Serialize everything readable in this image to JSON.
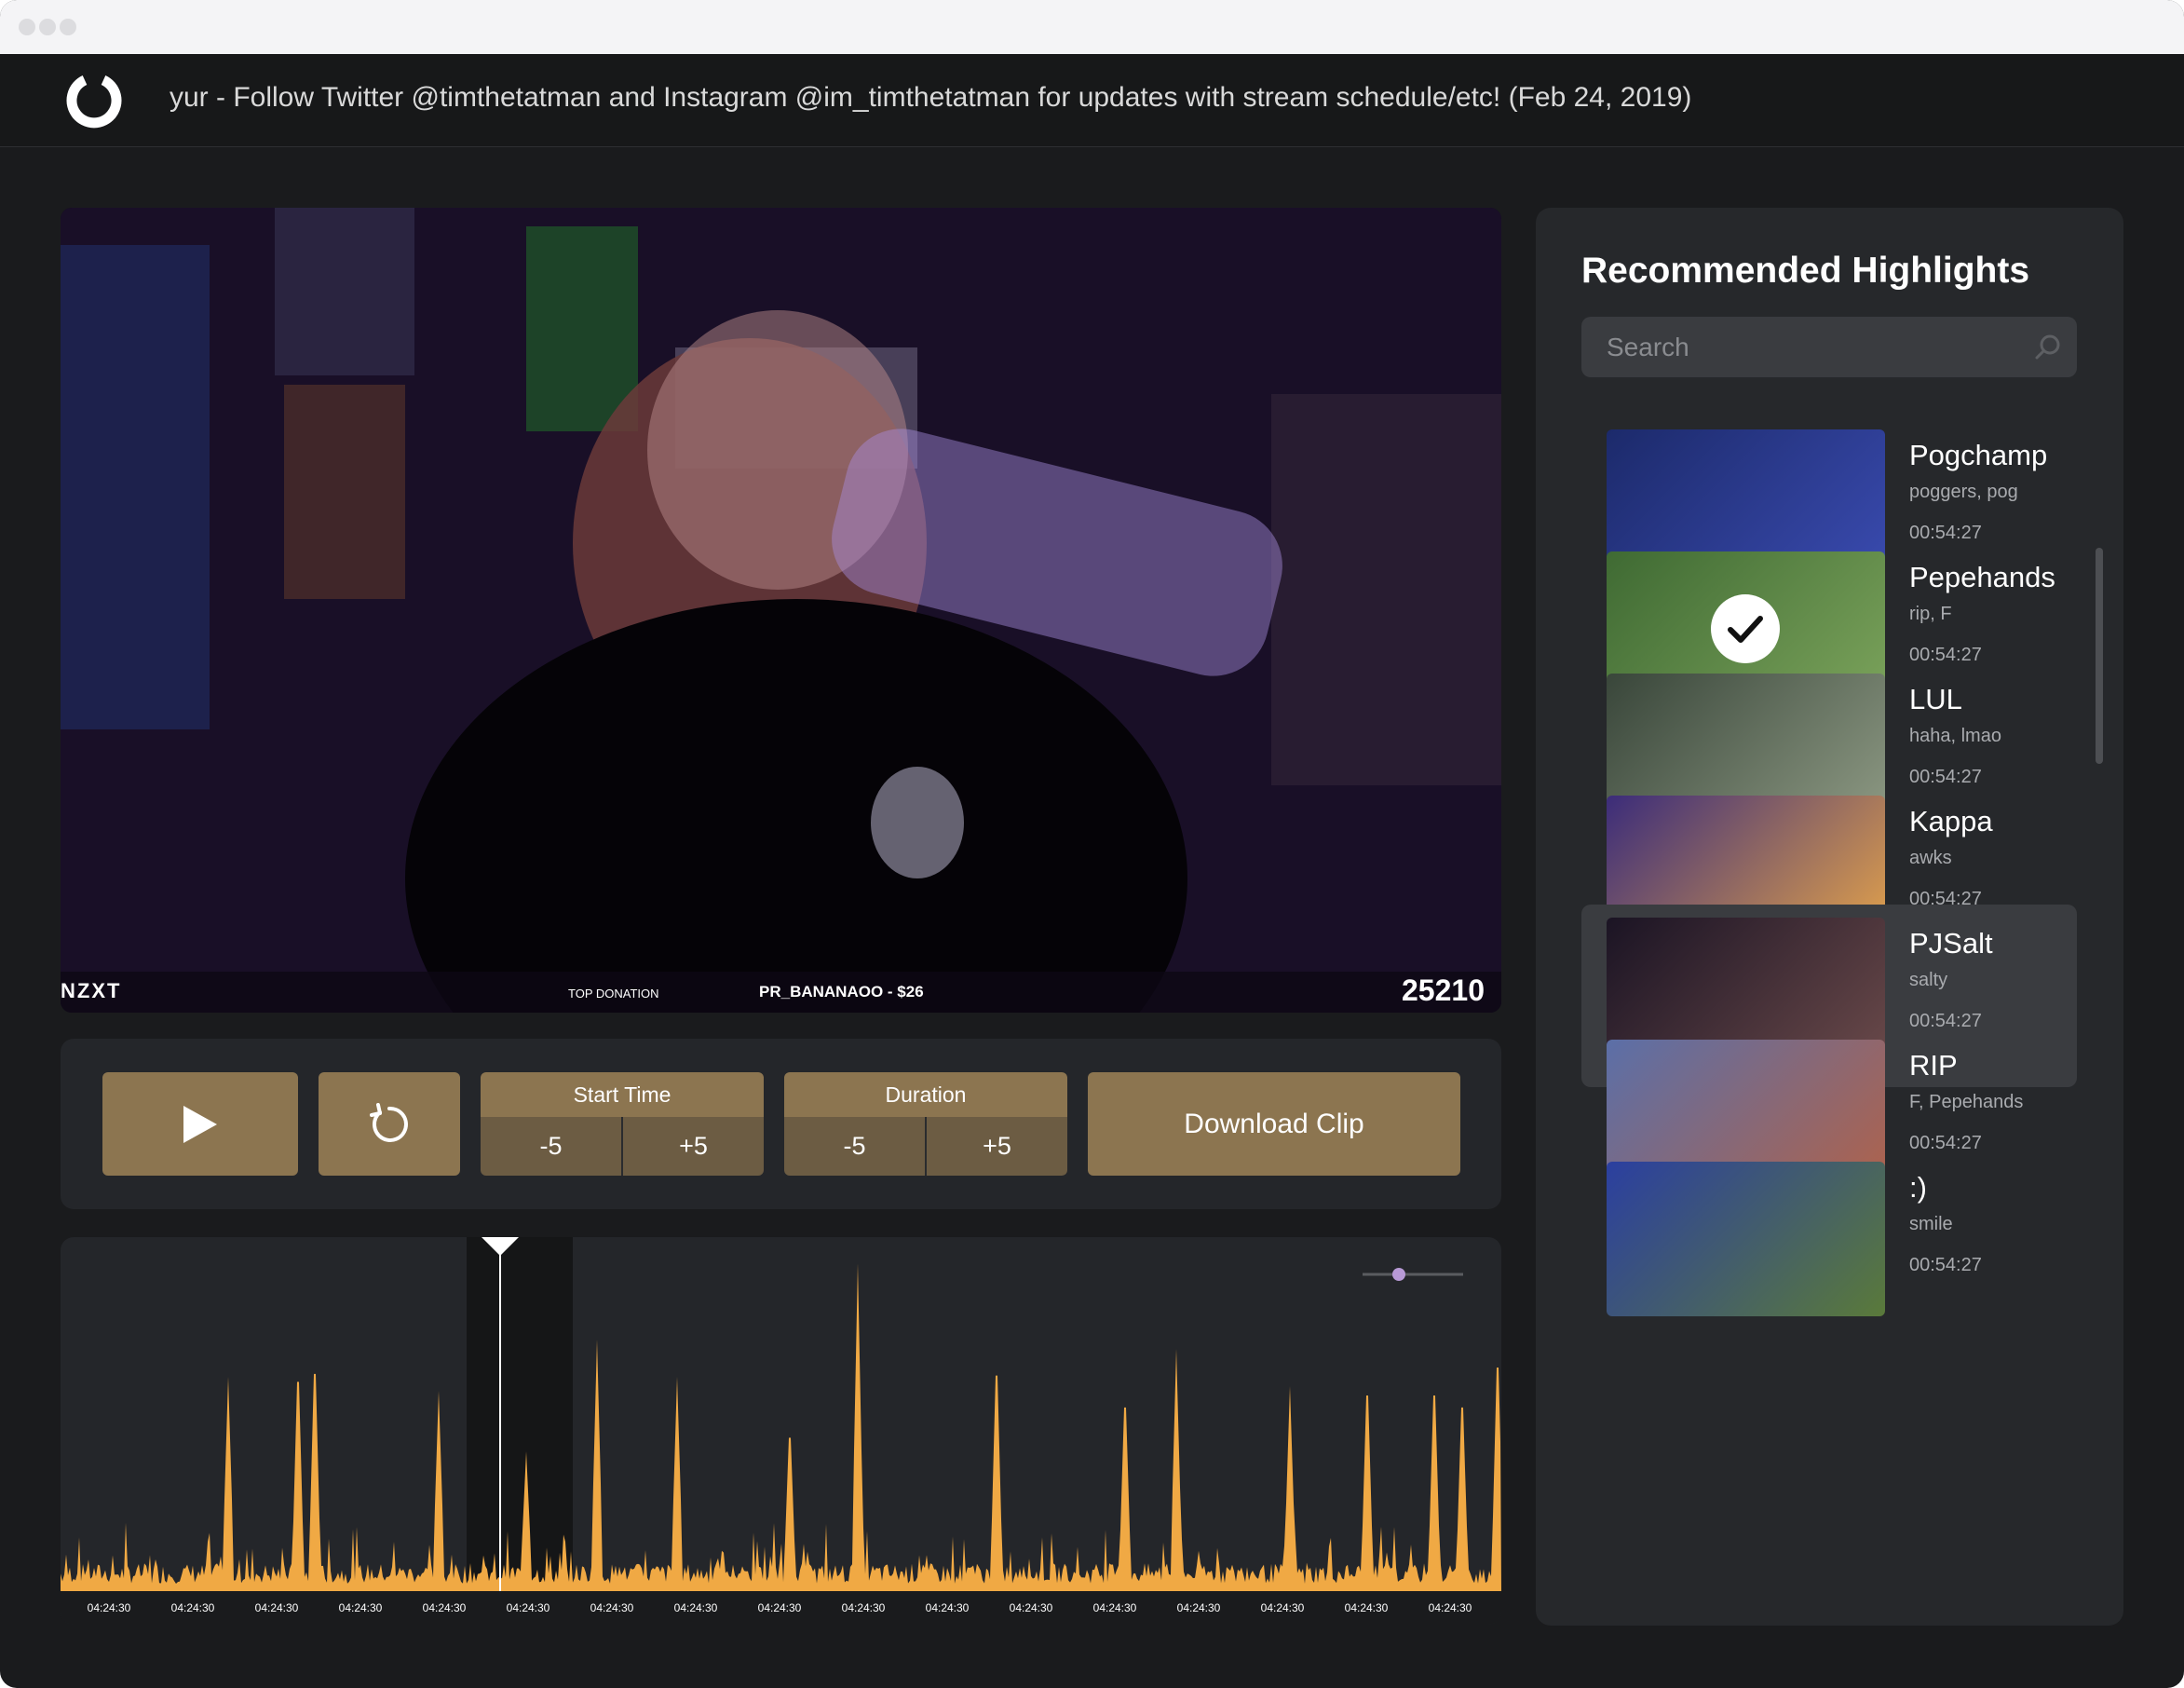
{
  "app": {
    "stream_title": "yur - Follow Twitter @timthetatman and Instagram @im_timthetatman for updates with stream schedule/etc! (Feb 24, 2019)",
    "logo_icon": "power-ring-logo-icon"
  },
  "video": {
    "overlay_left": "NZXT",
    "overlay_top_donation": "TOP DONATION",
    "overlay_donor": "PR_BANANAOO - $26",
    "overlay_count": "25210"
  },
  "controls": {
    "play_icon": "play-icon",
    "replay_icon": "replay-icon",
    "start_time_label": "Start Time",
    "start_minus": "-5",
    "start_plus": "+5",
    "duration_label": "Duration",
    "duration_minus": "-5",
    "duration_plus": "+5",
    "download_label": "Download Clip",
    "accent_color": "#8c7550",
    "accent_dark_color": "#6c5c43"
  },
  "timeline": {
    "tick_labels": [
      "04:24:30",
      "04:24:30",
      "04:24:30",
      "04:24:30",
      "04:24:30",
      "04:24:30",
      "04:24:30",
      "04:24:30",
      "04:24:30",
      "04:24:30",
      "04:24:30",
      "04:24:30",
      "04:24:30",
      "04:24:30",
      "04:24:30",
      "04:24:30",
      "04:24:30"
    ],
    "wave_color": "#f0a944"
  },
  "highlights": {
    "title": "Recommended Highlights",
    "search_placeholder": "Search",
    "items": [
      {
        "name": "Pogchamp",
        "tags": "poggers, pog",
        "time": "00:54:27",
        "selected": false,
        "checked": false
      },
      {
        "name": "Pepehands",
        "tags": "rip, F",
        "time": "00:54:27",
        "selected": false,
        "checked": true
      },
      {
        "name": "LUL",
        "tags": "haha, lmao",
        "time": "00:54:27",
        "selected": false,
        "checked": false
      },
      {
        "name": "Kappa",
        "tags": "awks",
        "time": "00:54:27",
        "selected": false,
        "checked": false
      },
      {
        "name": "PJSalt",
        "tags": "salty",
        "time": "00:54:27",
        "selected": true,
        "checked": false
      },
      {
        "name": "RIP",
        "tags": "F, Pepehands",
        "time": "00:54:27",
        "selected": false,
        "checked": false
      },
      {
        "name": ":)",
        "tags": "smile",
        "time": "00:54:27",
        "selected": false,
        "checked": false
      }
    ]
  }
}
